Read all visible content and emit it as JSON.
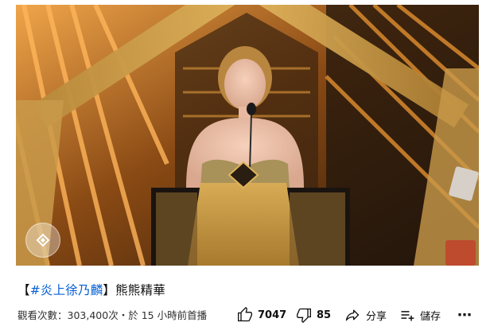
{
  "title": {
    "bracket_open": "【",
    "hashtag": "#炎上徐乃麟",
    "bracket_close": "】",
    "text": "熊熊精華"
  },
  "meta": {
    "views_label": "觀看次數：",
    "views": "303,400次",
    "separator": "・",
    "published": "於 15 小時前首播"
  },
  "actions": {
    "like_count": "7047",
    "dislike_count": "85",
    "share_label": "分享",
    "save_label": "儲存",
    "more_label": "⋯"
  },
  "icons": {
    "like": "thumbs-up-icon",
    "dislike": "thumbs-down-icon",
    "share": "share-icon",
    "save": "playlist-add-icon",
    "more": "more-icon",
    "watermark": "channel-watermark-icon"
  },
  "colors": {
    "hashtag": "#065fd4",
    "stage_gold": "#e8a23a",
    "stage_dark": "#2a1708"
  }
}
